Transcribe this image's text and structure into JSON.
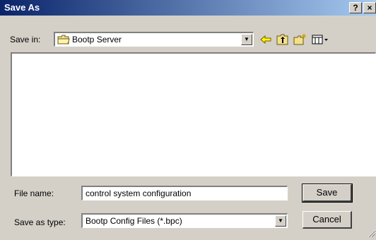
{
  "window": {
    "title": "Save As",
    "help_label": "?",
    "close_label": "×"
  },
  "save_in": {
    "label": "Save in:",
    "value": "Bootp Server"
  },
  "toolbar": {
    "back_icon": "back-arrow-icon",
    "up_icon": "up-folder-icon",
    "new_folder_icon": "new-folder-icon",
    "view_menu_icon": "view-menu-icon"
  },
  "file_name": {
    "label": "File name:",
    "value": "control system configuration"
  },
  "save_as_type": {
    "label": "Save as type:",
    "value": "Bootp Config Files (*.bpc)"
  },
  "buttons": {
    "save": "Save",
    "cancel": "Cancel"
  },
  "colors": {
    "title_start": "#0a246a",
    "title_end": "#a6caf0",
    "dialog_face": "#d4d0c8"
  }
}
